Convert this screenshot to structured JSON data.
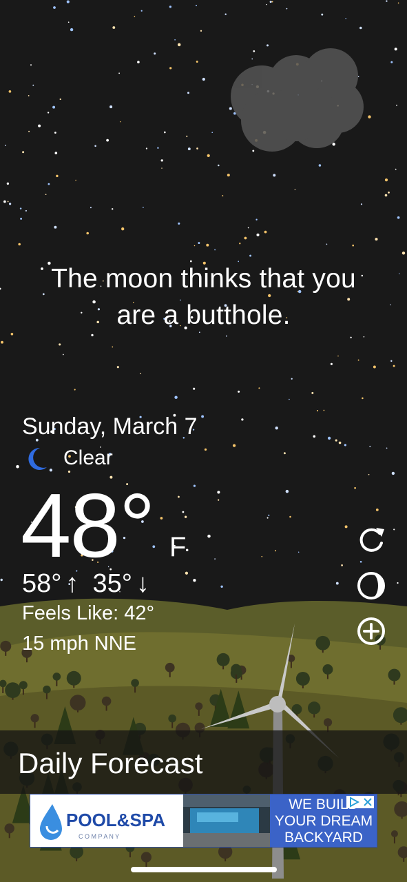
{
  "tagline": {
    "line1": "The moon thinks that you",
    "line2": "are a butthole."
  },
  "current": {
    "date": "Sunday, March 7",
    "condition": "Clear",
    "condition_icon": "crescent-moon-icon",
    "temperature": "48°",
    "unit": "F",
    "high": "58°",
    "low": "35°",
    "high_arrow": "↑",
    "low_arrow": "↓",
    "feels_like": "Feels Like: 42°",
    "wind": "15 mph NNE"
  },
  "side_actions": [
    {
      "name": "refresh-icon"
    },
    {
      "name": "moon-phase-icon"
    },
    {
      "name": "add-location-icon"
    }
  ],
  "forecast": {
    "title": "Daily Forecast"
  },
  "ad": {
    "brand": "POOL&SPA",
    "brand_sub": "C O M P A N Y",
    "cta_line1": "WE BUILD",
    "cta_line2": "YOUR DREAM",
    "cta_line3": "BACKYARD"
  },
  "colors": {
    "sky": "#181818",
    "hills": "#6b6a2e",
    "moon_icon": "#2f6be0",
    "ad_blue": "#3b63c7"
  }
}
